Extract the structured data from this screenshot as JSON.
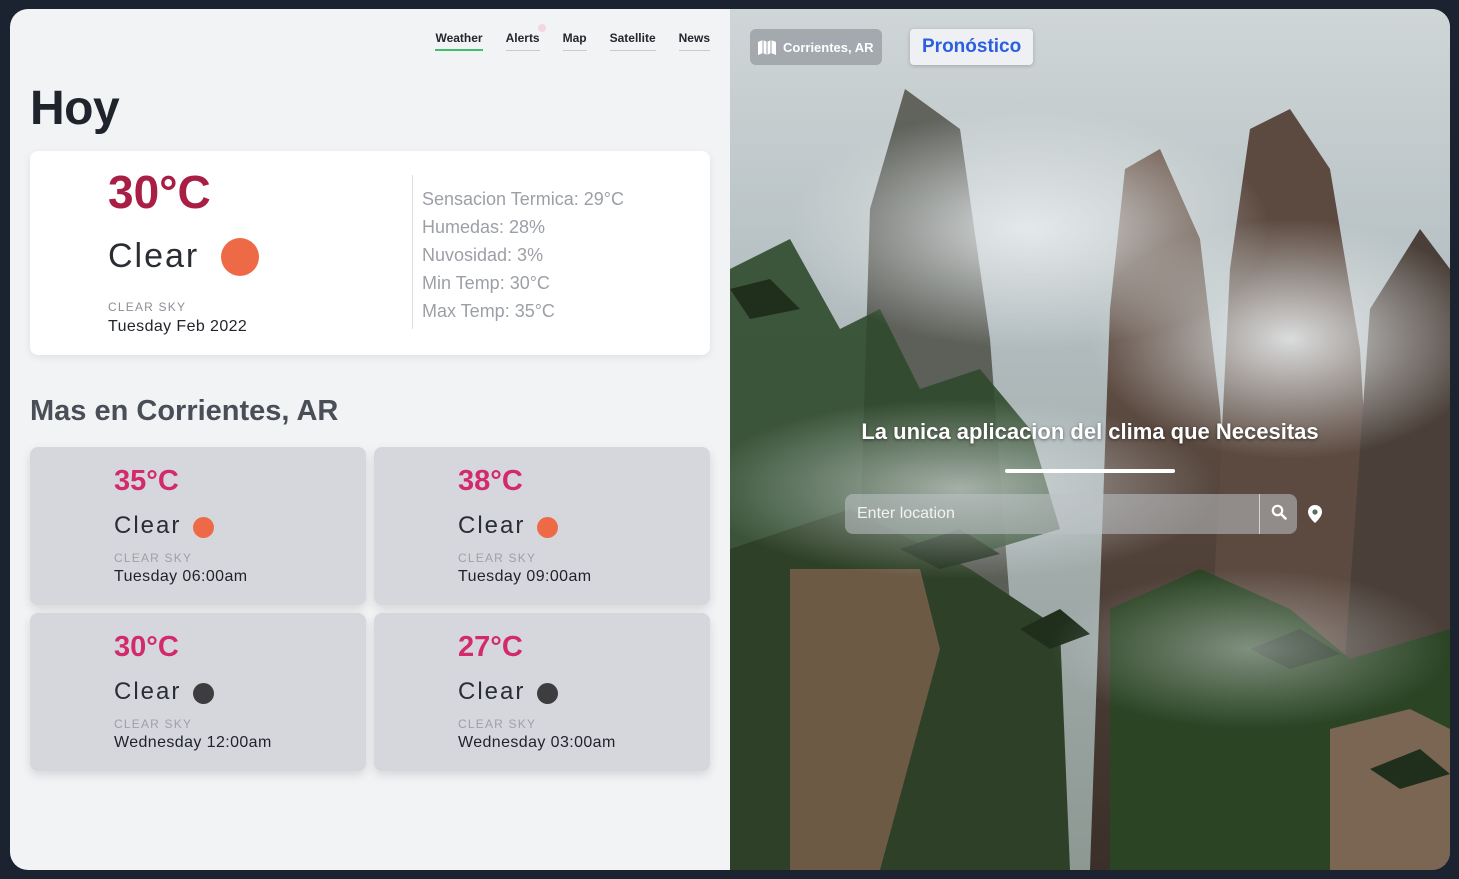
{
  "nav": {
    "items": [
      {
        "label": "Weather",
        "active": true
      },
      {
        "label": "Alerts",
        "active": false
      },
      {
        "label": "Map",
        "active": false
      },
      {
        "label": "Satellite",
        "active": false
      },
      {
        "label": "News",
        "active": false
      }
    ]
  },
  "today": {
    "heading": "Hoy",
    "temp": "30°C",
    "condition": "Clear",
    "condition_icon": "sun-icon",
    "description": "CLEAR SKY",
    "date": "Tuesday Feb 2022",
    "details": [
      "Sensacion Termica: 29°C",
      "Humedas: 28%",
      "Nuvosidad: 3%",
      "Min Temp: 30°C",
      "Max Temp: 35°C"
    ]
  },
  "forecast": {
    "heading": "Mas en Corrientes, AR",
    "cards": [
      {
        "temp": "35°C",
        "condition": "Clear",
        "description": "CLEAR SKY",
        "time": "Tuesday 06:00am",
        "icon": "sun-icon",
        "icon_color": "#ee6a47"
      },
      {
        "temp": "38°C",
        "condition": "Clear",
        "description": "CLEAR SKY",
        "time": "Tuesday 09:00am",
        "icon": "sun-icon",
        "icon_color": "#ee6a47"
      },
      {
        "temp": "30°C",
        "condition": "Clear",
        "description": "CLEAR SKY",
        "time": "Wednesday 12:00am",
        "icon": "moon-icon",
        "icon_color": "#3d3d3f"
      },
      {
        "temp": "27°C",
        "condition": "Clear",
        "description": "CLEAR SKY",
        "time": "Wednesday 03:00am",
        "icon": "moon-icon",
        "icon_color": "#3d3d3f"
      }
    ]
  },
  "hero": {
    "location_badge": "Corrientes, AR",
    "forecast_button": "Pronóstico",
    "tagline": "La unica aplicacion del clima que Necesitas",
    "search_placeholder": "Enter location"
  },
  "colors": {
    "accent_temp_today": "#a81e45",
    "accent_temp_forecast": "#d32a6d",
    "nav_active": "#3fbf6e",
    "button_text": "#2b5fe0"
  }
}
